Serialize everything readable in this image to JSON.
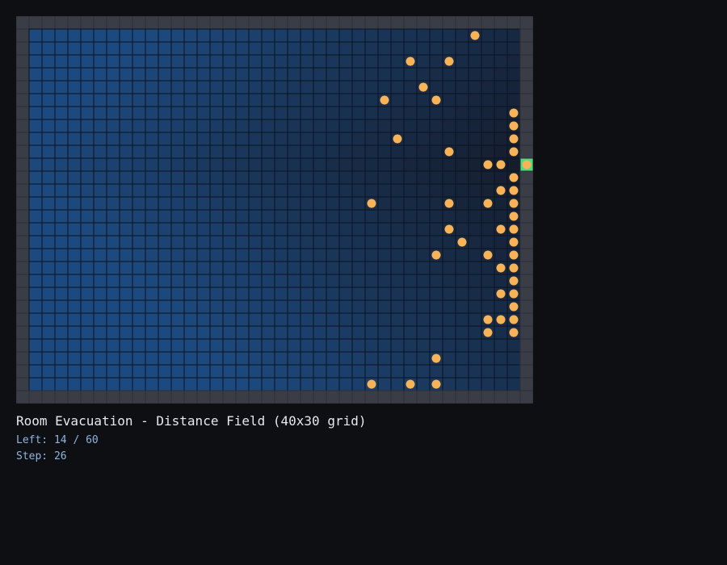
{
  "title": "Room Evacuation - Distance Field (40x30 grid)",
  "stats": {
    "left": "Left: 14 / 60",
    "step": "Step: 26"
  },
  "grid": {
    "cols": 40,
    "rows": 30,
    "exit": {
      "col": 39,
      "row": 11
    }
  },
  "agents": [
    [
      35,
      1
    ],
    [
      30,
      3
    ],
    [
      33,
      3
    ],
    [
      31,
      5
    ],
    [
      28,
      6
    ],
    [
      32,
      6
    ],
    [
      38,
      7
    ],
    [
      38,
      8
    ],
    [
      29,
      9
    ],
    [
      38,
      9
    ],
    [
      33,
      10
    ],
    [
      38,
      10
    ],
    [
      36,
      11
    ],
    [
      37,
      11
    ],
    [
      39,
      11
    ],
    [
      38,
      12
    ],
    [
      37,
      13
    ],
    [
      38,
      13
    ],
    [
      27,
      14
    ],
    [
      33,
      14
    ],
    [
      36,
      14
    ],
    [
      38,
      14
    ],
    [
      38,
      15
    ],
    [
      33,
      16
    ],
    [
      37,
      16
    ],
    [
      38,
      16
    ],
    [
      34,
      17
    ],
    [
      38,
      17
    ],
    [
      32,
      18
    ],
    [
      36,
      18
    ],
    [
      38,
      18
    ],
    [
      37,
      19
    ],
    [
      38,
      19
    ],
    [
      38,
      20
    ],
    [
      37,
      21
    ],
    [
      38,
      21
    ],
    [
      38,
      22
    ],
    [
      36,
      23
    ],
    [
      37,
      23
    ],
    [
      38,
      23
    ],
    [
      36,
      24
    ],
    [
      38,
      24
    ],
    [
      32,
      26
    ],
    [
      27,
      28
    ],
    [
      30,
      28
    ],
    [
      32,
      28
    ]
  ],
  "colors": {
    "background": "#0e0f13",
    "wall": "#3a3d45",
    "field_near": "#151c2b",
    "field_far": "#1d4a7e",
    "grid_line": "#0b1220",
    "agent": "#f8b356",
    "exit": "#4ade80"
  }
}
